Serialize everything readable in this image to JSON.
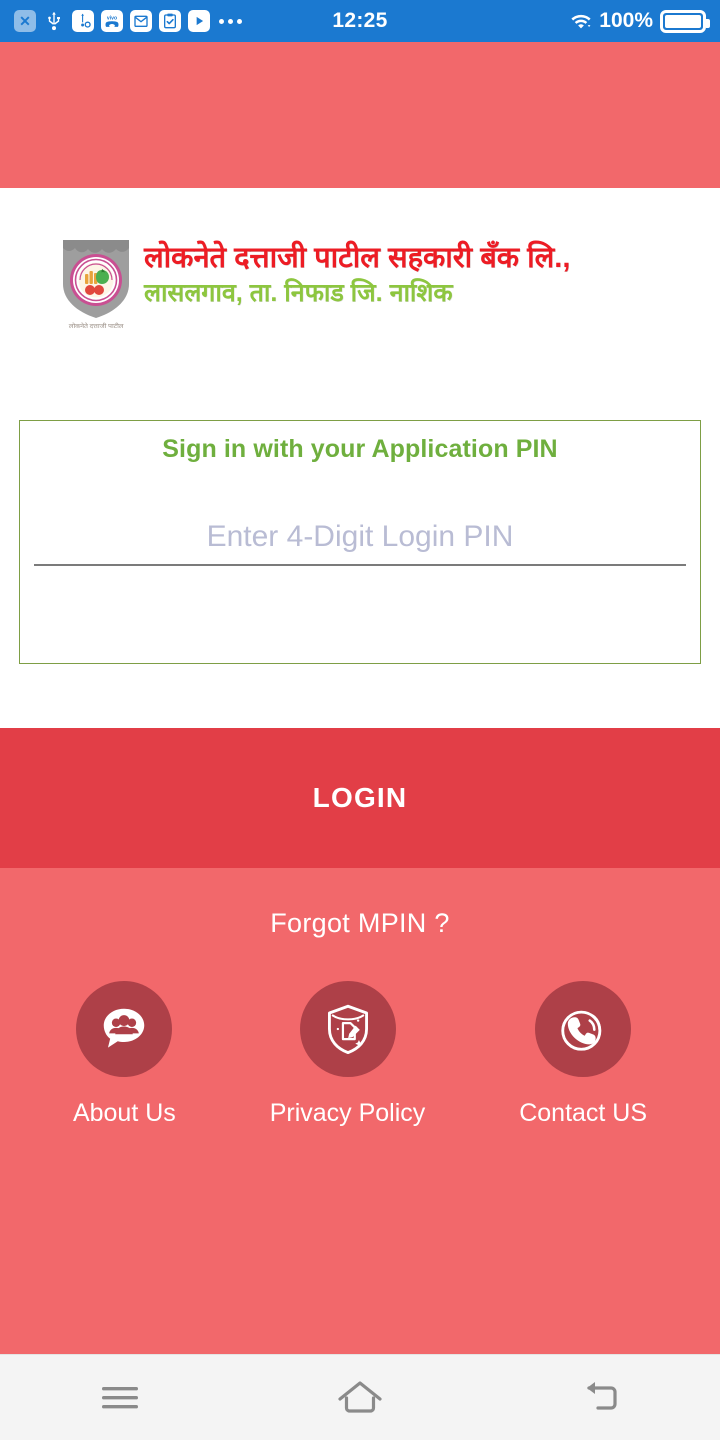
{
  "status_bar": {
    "clock": "12:25",
    "battery_percent": "100%",
    "left_icons": [
      {
        "name": "x-badge-icon",
        "glyph": "✕"
      },
      {
        "name": "usb-icon"
      },
      {
        "name": "usb-debug-icon"
      },
      {
        "name": "vivo-logo-icon"
      },
      {
        "name": "mail-icon"
      },
      {
        "name": "checklist-icon"
      },
      {
        "name": "play-icon"
      },
      {
        "name": "overflow-dots-icon"
      }
    ],
    "right_icons": [
      {
        "name": "wifi-icon"
      },
      {
        "name": "battery-icon"
      }
    ],
    "background_color": "#1B79D0"
  },
  "brand": {
    "name_line_1": "लोकनेते दत्ताजी पाटील सहकारी बँक लि.,",
    "name_line_2": "लासलगाव, ता. निफाड जि. नाशिक",
    "crest_caption": "लोकनेते दत्ताजी पाटील",
    "name_color_1": "#ED1C24",
    "name_color_2": "#8DC63F"
  },
  "signin_card": {
    "title": "Sign in with your Application PIN",
    "title_color": "#6FAF3E",
    "border_color": "#7E9E45",
    "pin_placeholder": "Enter 4-Digit Login PIN",
    "pin_value": ""
  },
  "login_button": {
    "label": "LOGIN",
    "background_color": "#E23E47"
  },
  "lower_panel": {
    "background_color": "#F2686B",
    "forgot_label": "Forgot MPIN ?",
    "quick_links": [
      {
        "label": "About Us",
        "icon": "people-chat-icon"
      },
      {
        "label": "Privacy Policy",
        "icon": "shield-document-icon"
      },
      {
        "label": "Contact US",
        "icon": "phone-call-icon"
      }
    ],
    "circle_color": "#AE4048"
  },
  "nav_bar": {
    "buttons": [
      {
        "name": "recents",
        "icon": "menu-icon"
      },
      {
        "name": "home",
        "icon": "home-icon"
      },
      {
        "name": "back",
        "icon": "back-arrow-icon"
      }
    ],
    "background_color": "#F4F4F4"
  }
}
